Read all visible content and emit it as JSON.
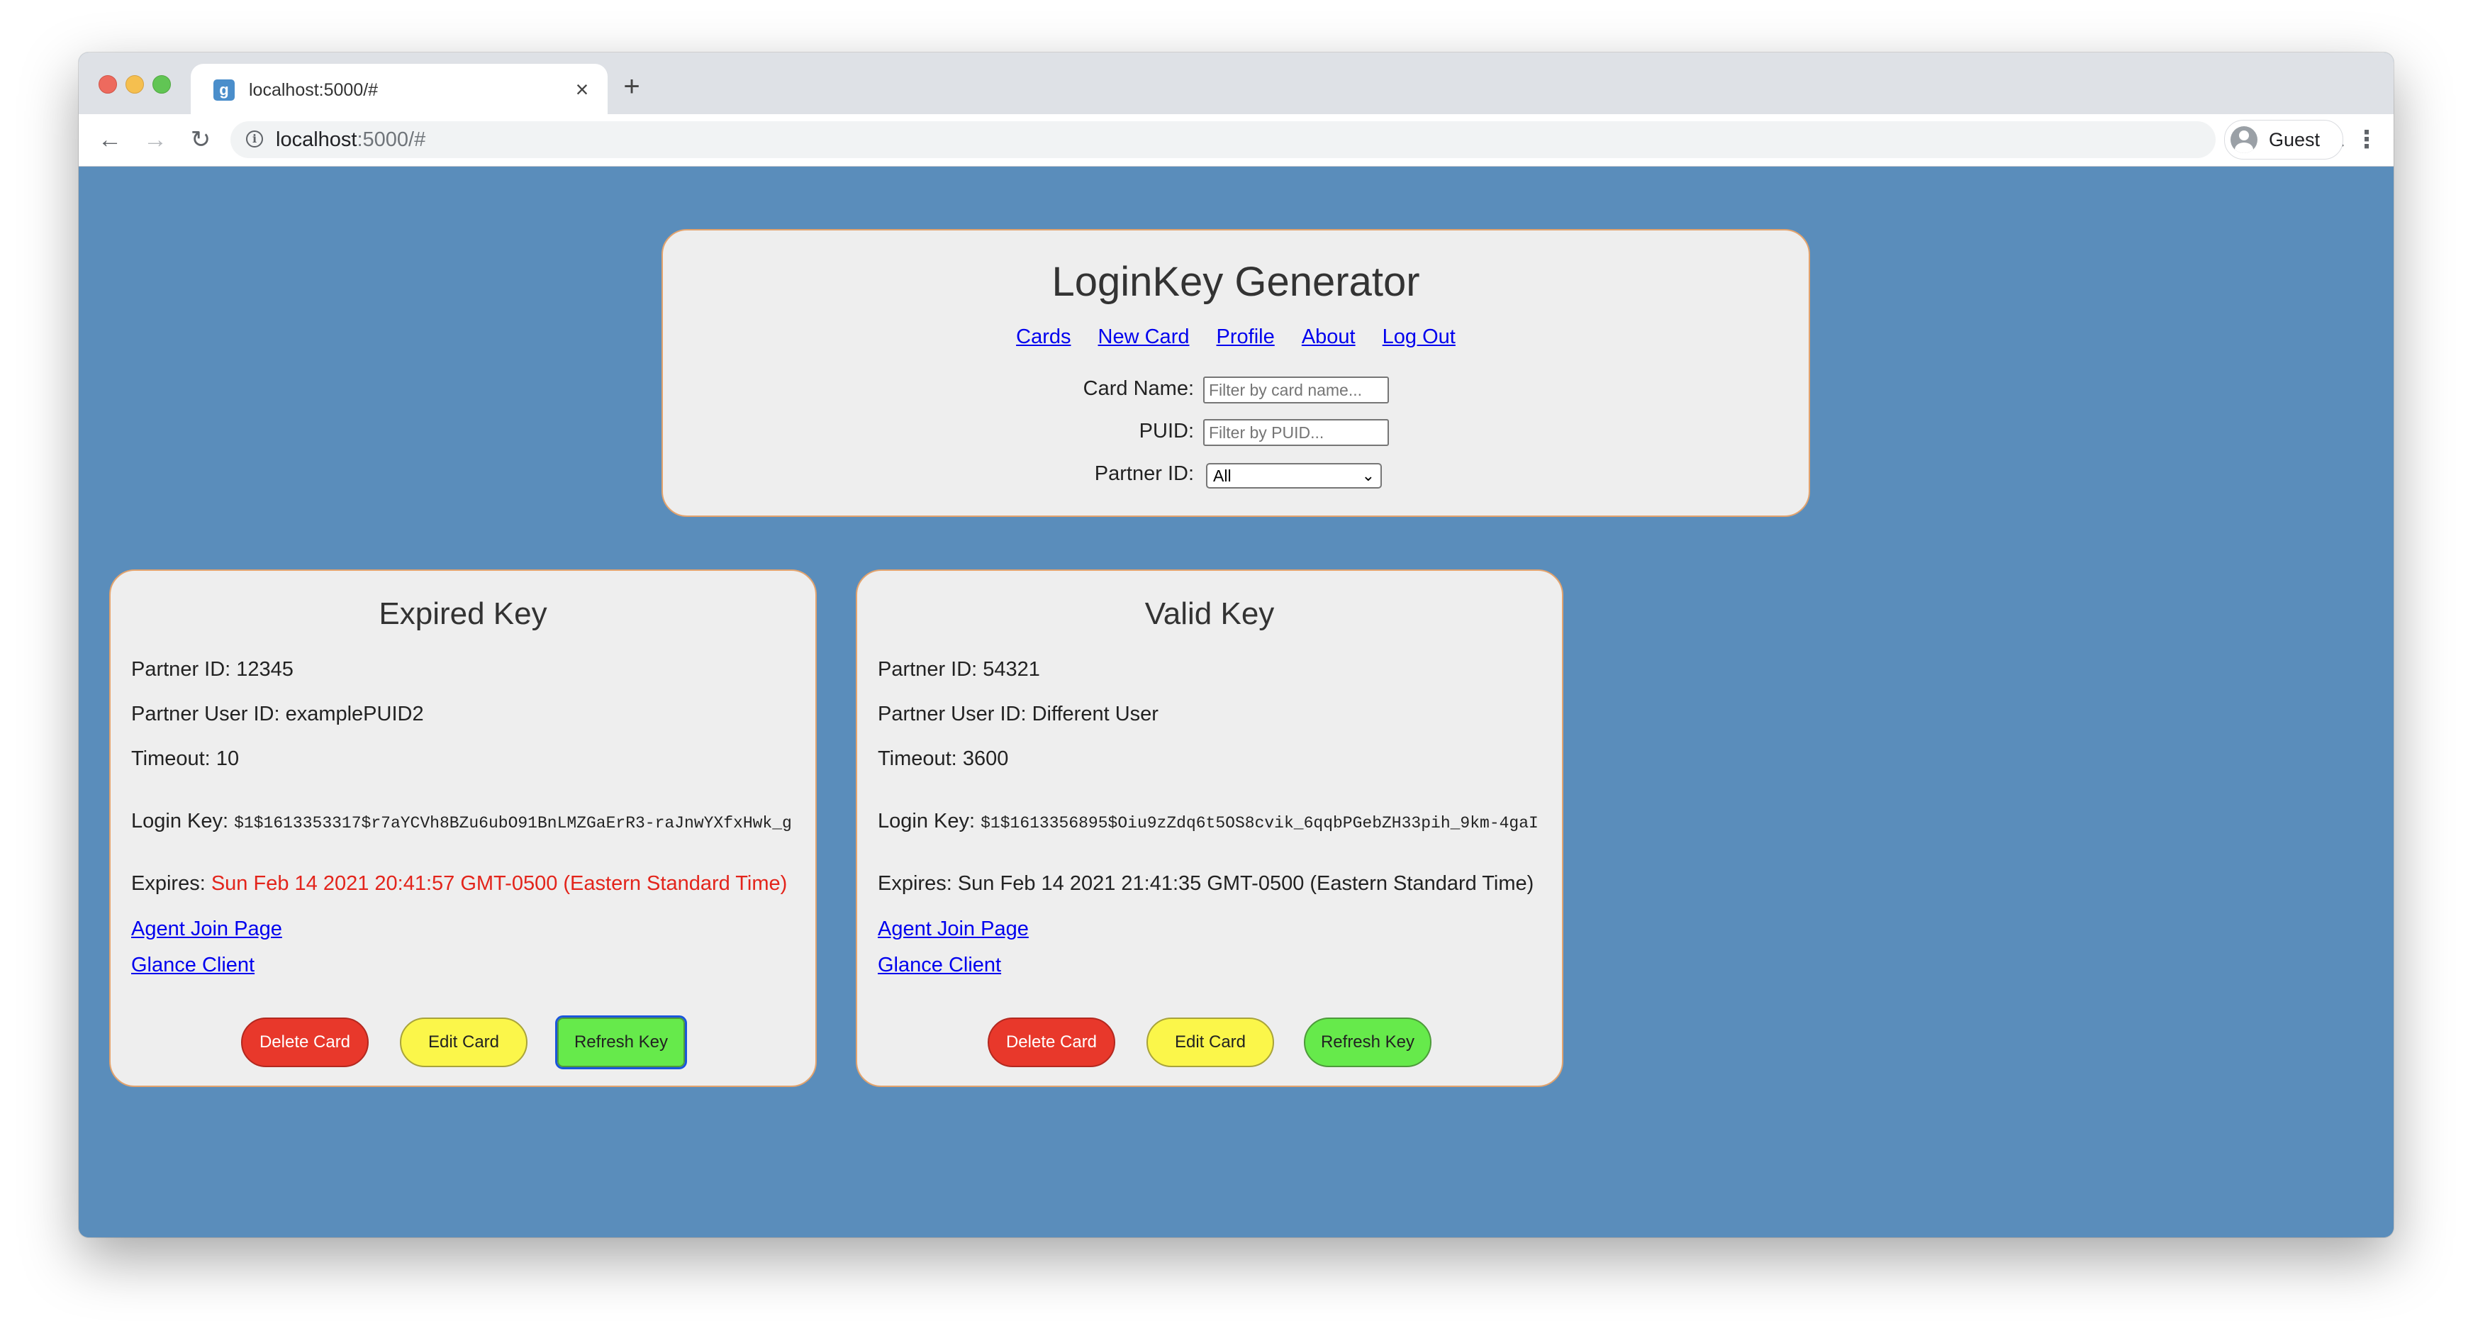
{
  "browser": {
    "tab_title": "localhost:5000/#",
    "tab_favicon_letter": "g",
    "url_host": "localhost",
    "url_rest": ":5000/#",
    "profile_name": "Guest",
    "icons": {
      "back": "arrow-left-icon",
      "forward": "arrow-right-icon",
      "reload": "reload-icon",
      "info": "info-icon",
      "zoom": "zoom-icon",
      "menu": "kebab-menu-icon",
      "close": "close-icon",
      "new_tab": "plus-icon"
    }
  },
  "header": {
    "title": "LoginKey Generator",
    "nav": [
      "Cards",
      "New Card",
      "Profile",
      "About",
      "Log Out"
    ],
    "filters": {
      "card_name_label": "Card Name:",
      "card_name_placeholder": "Filter by card name...",
      "puid_label": "PUID:",
      "puid_placeholder": "Filter by PUID...",
      "partner_id_label": "Partner ID:",
      "partner_id_selected": "All"
    }
  },
  "labels": {
    "partner_id": "Partner ID:",
    "partner_user_id": "Partner User ID:",
    "timeout": "Timeout:",
    "login_key": "Login Key:",
    "expires": "Expires:",
    "agent_join": "Agent Join Page",
    "glance_client": "Glance Client",
    "delete": "Delete Card",
    "edit": "Edit Card",
    "refresh": "Refresh Key"
  },
  "cards": [
    {
      "title": "Expired Key",
      "partner_id": "12345",
      "partner_user_id": "examplePUID2",
      "timeout": "10",
      "login_key": "$1$1613353317$r7aYCVh8BZu6ubO91BnLMZGaErR3-raJnwYXfxHwk_g",
      "expires": "Sun Feb 14 2021 20:41:57 GMT-0500 (Eastern Standard Time)",
      "expired": true
    },
    {
      "title": "Valid Key",
      "partner_id": "54321",
      "partner_user_id": "Different User",
      "timeout": "3600",
      "login_key": "$1$1613356895$Oiu9zZdq6t5OS8cvik_6qqbPGebZH33pih_9km-4gaI",
      "expires": "Sun Feb 14 2021 21:41:35 GMT-0500 (Eastern Standard Time)",
      "expired": false
    }
  ],
  "colors": {
    "page_bg": "#5a8dbb",
    "card_bg": "#eeeeee",
    "card_border": "#e3a36d",
    "expired_text": "#e3241b",
    "delete_button": "#e8382b",
    "edit_button": "#fbf64a",
    "refresh_button": "#66ea4b"
  }
}
